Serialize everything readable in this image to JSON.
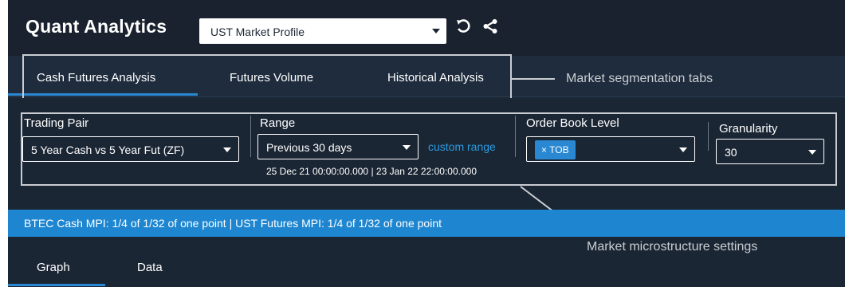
{
  "header": {
    "title": "Quant Analytics",
    "profile_select": {
      "value": "UST Market Profile",
      "options": [
        "UST Market Profile"
      ]
    },
    "icons": [
      "undo-icon",
      "share-icon"
    ]
  },
  "tabs": [
    {
      "label": "Cash Futures Analysis",
      "active": true
    },
    {
      "label": "Futures Volume",
      "active": false
    },
    {
      "label": "Historical Analysis",
      "active": false
    }
  ],
  "annotations": {
    "tabs_callout": "Market segmentation tabs",
    "settings_callout": "Market microstructure settings"
  },
  "settings": {
    "trading_pair": {
      "label": "Trading Pair",
      "value": "5 Year Cash vs 5 Year Fut (ZF)"
    },
    "range": {
      "label": "Range",
      "value": "Previous 30 days",
      "custom_link": "custom range",
      "span": "25 Dec 21 00:00:00.000 | 23 Jan 22 22:00:00.000"
    },
    "order_book_level": {
      "label": "Order Book Level",
      "chip": "TOB",
      "chip_remove": "×"
    },
    "granularity": {
      "label": "Granularity",
      "value": "30"
    }
  },
  "banner": {
    "text": "BTEC Cash MPI: 1/4 of 1/32 of one point | UST Futures MPI: 1/4 of 1/32 of one point"
  },
  "bottom_tabs": [
    {
      "label": "Graph",
      "active": true
    },
    {
      "label": "Data",
      "active": false
    }
  ],
  "colors": {
    "background": "#1b2634",
    "header": "#19222e",
    "accent": "#2a88d2",
    "link": "#2a9be0",
    "callout": "#c9cdd2"
  }
}
